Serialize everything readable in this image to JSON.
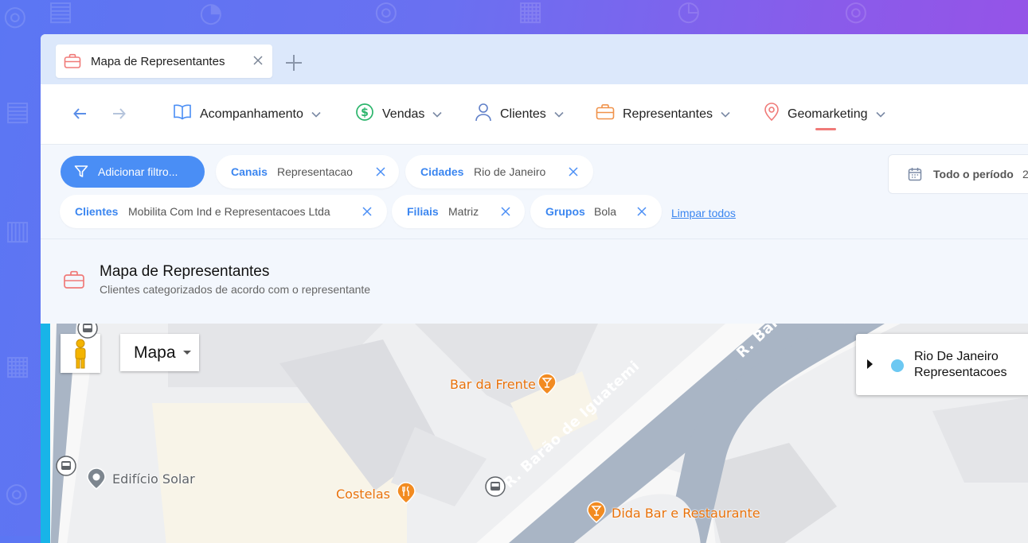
{
  "tab": {
    "title": "Mapa de Representantes"
  },
  "nav": {
    "menu": [
      {
        "label": "Acompanhamento",
        "icon": "book-icon"
      },
      {
        "label": "Vendas",
        "icon": "dollar-circle-icon"
      },
      {
        "label": "Clientes",
        "icon": "person-icon"
      },
      {
        "label": "Representantes",
        "icon": "briefcase-icon"
      },
      {
        "label": "Geomarketing",
        "icon": "location-pin-icon"
      }
    ]
  },
  "filters": {
    "add_label": "Adicionar filtro...",
    "chips": [
      {
        "key": "Canais",
        "value": "Representacao"
      },
      {
        "key": "Cidades",
        "value": "Rio de Janeiro"
      },
      {
        "key": "Clientes",
        "value": "Mobilita Com Ind e Representacoes Ltda"
      },
      {
        "key": "Filiais",
        "value": "Matriz"
      },
      {
        "key": "Grupos",
        "value": "Bola"
      }
    ],
    "clear_label": "Limpar todos",
    "date_label": "Todo o período",
    "date_value": "2"
  },
  "page": {
    "title": "Mapa de Representantes",
    "subtitle": "Clientes categorizados de acordo com o representante"
  },
  "map": {
    "type_label": "Mapa",
    "legend": {
      "line1": "Rio De Janeiro",
      "line2": "Representacoes",
      "color": "#6cc8f2"
    },
    "pois": {
      "bar_frente": "Bar da Frente",
      "edificio": "Edifício Solar",
      "costelas": "Costelas",
      "dida": "Dida Bar e Restaurante"
    },
    "streets": {
      "main": "R. Barão de Iguatemi",
      "top": "R. Barã"
    }
  },
  "colors": {
    "accent": "#4a8ef5",
    "active_underline": "#f07a78",
    "briefcase": "#f07a78"
  }
}
